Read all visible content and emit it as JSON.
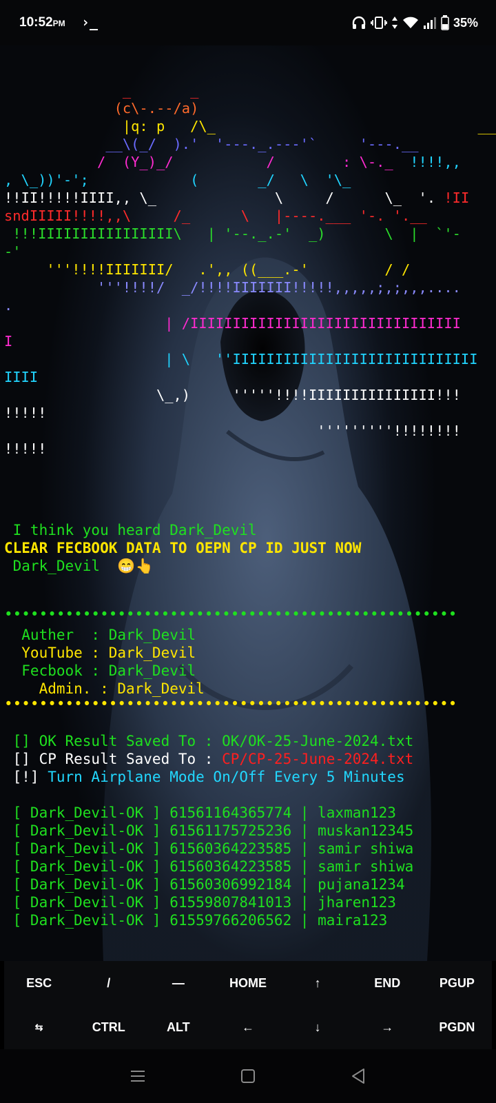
{
  "status": {
    "time": "10:52",
    "ampm": "PM",
    "terminal_glyph": "›_",
    "battery": "35%"
  },
  "ascii": {
    "l1": "              _       _",
    "l2": "             (c\\-.--/a)",
    "l3": "              |q: p   /\\_",
    "l3b": "                               _____",
    "l4a": "            __\\(_/  ).'  '---._.---'`     '---.__",
    "l5a": "           /  (Y_)_/           /        : \\-._",
    "l5b": "  !!!!,,",
    "l6": ", \\_))'-';",
    "l6b": "            (       _/   \\  '\\_",
    "l7a": "!!II!!!!!IIII,, \\_",
    "l7b": "              \\     /      \\_  '. ",
    "l7c": "!II",
    "l8a": "sndIIIII!!!!,,\\",
    "l8b": "     /_      \\   |----.___ '-. '.__",
    "l9a": " !!!IIIIIIIIIIIIIIII\\",
    "l9b": "   | '--._.-'  _)       \\  |  `'-",
    "l10": "-'",
    "l11a": "     '''!!!!IIIIIII/",
    "l11b": "   .',, ((___.-'         / /",
    "l12": "           '''!!!!/  _/!!!!IIIIIII!!!!!,,,,,;,;,,,....",
    "l13": ".",
    "l14": "                   | /IIIIIIIIIIIIIIIIIIIIIIIIIIIIIIII",
    "l15": "I",
    "l16": "                   | \\   ''IIIIIIIIIIIIIIIIIIIIIIIIIIIII",
    "l17": "IIII",
    "l18": "                  \\_,)     '''''!!!!IIIIIIIIIIIIIII!!!",
    "l19": "!!!!!",
    "l20": "                                     '''''''''!!!!!!!!",
    "l21": "!!!!!"
  },
  "banner": {
    "heard": " I think you heard Dark_Devil",
    "clear": "CLEAR FECBOOK DATA TO OEPN CP ID JUST NOW",
    "name": " Dark_Devil  😁👆",
    "dots": "••••••••••••••••••••••••••••••••••••••••••••••••••••",
    "auther": "  Auther  : Dark_Devil",
    "youtube": "  YouTube : Dark_Devil",
    "fecbook": "  Fecbook : Dark_Devil",
    "admin": "    Admin. : Dark_Devil"
  },
  "results": {
    "ok_prefix": " [] OK Result Saved To : ",
    "ok_file": "OK/OK-25-June-2024.txt",
    "cp_prefix": " [] CP Result Saved To : ",
    "cp_file": "CP/CP-25-June-2024.txt",
    "airplane_prefix": " [!] ",
    "airplane": "Turn Airplane Mode On/Off Every 5 Minutes"
  },
  "ok_lines": [
    " [ Dark_Devil-OK ] 61561164365774 | laxman123",
    " [ Dark_Devil-OK ] 61561175725236 | muskan12345",
    " [ Dark_Devil-OK ] 61560364223585 | samir shiwa",
    " [ Dark_Devil-OK ] 61560364223585 | samir shiwa",
    " [ Dark_Devil-OK ] 61560306992184 | pujana1234",
    " [ Dark_Devil-OK ] 61559807841013 | jharen123",
    " [ Dark_Devil-OK ] 61559766206562 | maira123"
  ],
  "extra_keys": {
    "row1": [
      "ESC",
      "/",
      "—",
      "HOME",
      "↑",
      "END",
      "PGUP"
    ],
    "row2": [
      "⇆",
      "CTRL",
      "ALT",
      "←",
      "↓",
      "→",
      "PGDN"
    ]
  },
  "navbar": {
    "recents_icon": "recents-icon",
    "home_icon": "home-icon",
    "back_icon": "back-icon"
  }
}
